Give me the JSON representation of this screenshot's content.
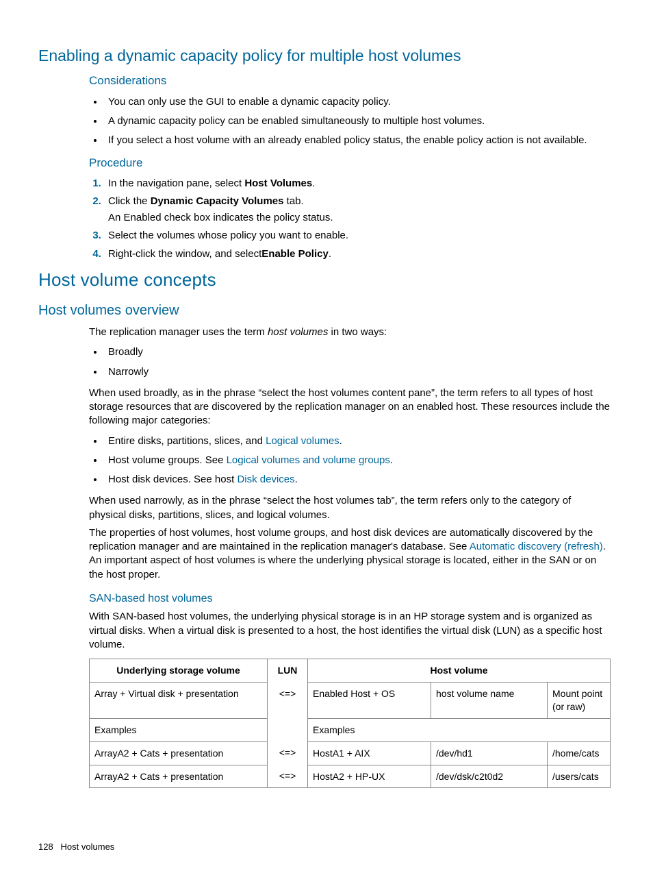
{
  "section1": {
    "title": "Enabling a dynamic capacity policy for multiple host volumes",
    "considerationsHeading": "Considerations",
    "considerations": [
      "You can only use the GUI to enable a dynamic capacity policy.",
      "A dynamic capacity policy can be enabled simultaneously to multiple host volumes.",
      "If you select a host volume with an already enabled policy status, the enable policy action is not available."
    ],
    "procedureHeading": "Procedure",
    "steps": {
      "s1a": "In the navigation pane, select ",
      "s1b": "Host Volumes",
      "s1c": ".",
      "s2a": "Click the ",
      "s2b": "Dynamic Capacity Volumes",
      "s2c": " tab.",
      "s2sub": "An Enabled check box indicates the policy status.",
      "s3": "Select the volumes whose policy you want to enable.",
      "s4a": "Right-click the window, and select",
      "s4b": "Enable Policy",
      "s4c": "."
    }
  },
  "section2": {
    "title": "Host volume concepts",
    "overviewHeading": "Host volumes overview",
    "intro1a": "The replication manager uses the term ",
    "intro1b": "host volumes",
    "intro1c": " in two ways:",
    "ways": [
      "Broadly",
      "Narrowly"
    ],
    "broadlyPara": "When used broadly, as in the phrase “select the host volumes content pane”, the term refers to all types of host storage resources that are discovered by the replication manager on an enabled host. These resources include the following major categories:",
    "cat1a": "Entire disks, partitions, slices, and ",
    "cat1link": "Logical volumes",
    "cat1b": ".",
    "cat2a": "Host volume groups. See ",
    "cat2link": "Logical volumes and volume groups",
    "cat2b": ".",
    "cat3a": "Host disk devices. See host ",
    "cat3link": "Disk devices",
    "cat3b": ".",
    "narrowPara": "When used narrowly, as in the phrase “select the host volumes tab”, the term refers only to the category of physical disks, partitions, slices, and logical volumes.",
    "propsPara1": "The properties of host volumes, host volume groups, and host disk devices are automatically discovered by the replication manager and are maintained in the replication manager's database. See ",
    "propsLink": "Automatic discovery (refresh)",
    "propsPara2": ". An important aspect of host volumes is where the underlying physical storage is located, either in the SAN or on the host proper.",
    "sanHeading": "SAN-based host volumes",
    "sanPara": "With SAN-based host volumes, the underlying physical storage is in an HP storage system and is organized as virtual disks. When a virtual disk is presented to a host, the host identifies the virtual disk (LUN) as a specific host volume."
  },
  "table": {
    "h_underlying": "Underlying storage volume",
    "h_lun": "LUN",
    "h_hostvol": "Host volume",
    "r1_usv": "Array + Virtual disk + presentation",
    "arrow": "<=>",
    "r1_hv1": "Enabled Host + OS",
    "r1_hv2": "host volume name",
    "r1_hv3": "Mount point (or raw)",
    "examples": "Examples",
    "r3_usv": "ArrayA2 + Cats + presentation",
    "r3_hv1": "HostA1 + AIX",
    "r3_hv2": "/dev/hd1",
    "r3_hv3": "/home/cats",
    "r4_usv": "ArrayA2 + Cats + presentation",
    "r4_hv1": "HostA2 + HP-UX",
    "r4_hv2": "/dev/dsk/c2t0d2",
    "r4_hv3": "/users/cats"
  },
  "footer": {
    "pageNum": "128",
    "chapter": "Host volumes"
  }
}
